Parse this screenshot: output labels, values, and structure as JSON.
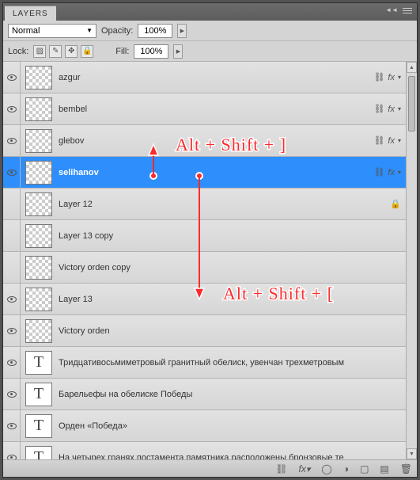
{
  "panel": {
    "title": "LAYERS"
  },
  "blend": {
    "mode": "Normal",
    "opacity_label": "Opacity:",
    "opacity_value": "100%"
  },
  "lock": {
    "label": "Lock:",
    "fill_label": "Fill:",
    "fill_value": "100%"
  },
  "layers": [
    {
      "name": "azgur",
      "visible": true,
      "thumb": "checker",
      "link": true,
      "fx": true,
      "selected": false
    },
    {
      "name": "bembel",
      "visible": true,
      "thumb": "checker",
      "link": true,
      "fx": true,
      "selected": false
    },
    {
      "name": "glebov",
      "visible": true,
      "thumb": "checker",
      "link": true,
      "fx": true,
      "selected": false
    },
    {
      "name": "selihanov",
      "visible": true,
      "thumb": "checker",
      "link": true,
      "fx": true,
      "selected": true
    },
    {
      "name": "Layer 12",
      "visible": false,
      "thumb": "checker",
      "locked": true,
      "selected": false
    },
    {
      "name": "Layer 13 copy",
      "visible": false,
      "thumb": "checker",
      "selected": false
    },
    {
      "name": "Victory orden copy",
      "visible": false,
      "thumb": "checker",
      "selected": false
    },
    {
      "name": "Layer 13",
      "visible": true,
      "thumb": "checker",
      "selected": false
    },
    {
      "name": "Victory orden",
      "visible": true,
      "thumb": "checker",
      "selected": false
    },
    {
      "name": "Тридцативосьмиметровый гранитный обелиск, увенчан трехметровым",
      "visible": true,
      "thumb": "text",
      "selected": false
    },
    {
      "name": "Барельефы на обелиске Победы",
      "visible": true,
      "thumb": "text",
      "selected": false
    },
    {
      "name": "Орден «Победа»",
      "visible": true,
      "thumb": "text",
      "selected": false
    },
    {
      "name": "На четырех гранях постамента памятника расположены бронзовые те",
      "visible": true,
      "thumb": "text",
      "selected": false
    }
  ],
  "annotation": {
    "up_label": "Alt + Shift + ]",
    "down_label": "Alt + Shift + ["
  }
}
